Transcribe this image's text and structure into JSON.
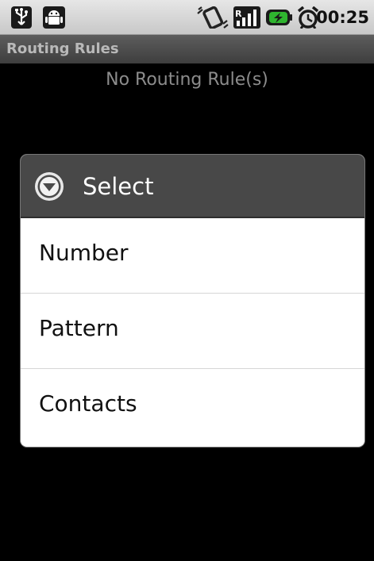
{
  "status_bar": {
    "icons": [
      "usb-icon",
      "android-icon",
      "vibrate-icon",
      "signal-icon",
      "battery-icon",
      "alarm-icon"
    ],
    "time": "00:25"
  },
  "app": {
    "title": "Routing Rules",
    "empty_message": "No Routing Rule(s)"
  },
  "dialog": {
    "icon": "chevron-down-circle-icon",
    "title": "Select",
    "items": [
      {
        "label": "Number"
      },
      {
        "label": "Pattern"
      },
      {
        "label": "Contacts"
      }
    ]
  },
  "colors": {
    "status_bar_bg": "#d8d8d8",
    "title_bar_bg": "#4a4a4a",
    "dialog_header_bg": "#484848",
    "battery_green": "#2fb52f"
  }
}
